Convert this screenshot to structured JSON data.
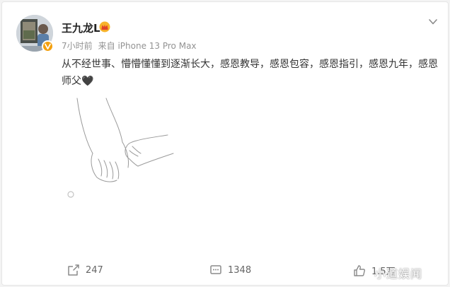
{
  "post": {
    "username": "王九龙L",
    "time": "7小时前",
    "source": "来自 iPhone 13 Pro Max",
    "text": "从不经世事、懵懵懂懂到逐渐长大，感恩教导，感恩包容，感恩指引，感恩九年，感恩师父🖤",
    "text_line1": "从不经世事、懵懵懂懂到逐渐长大，感恩教导，感恩包容，感恩指引，感恩九年，感恩",
    "text_line2": "师父🖤"
  },
  "icons": {
    "avatar": "avatar",
    "verified": "verified-badge-icon",
    "crown": "crown-icon",
    "more": "chevron-down-icon",
    "repost": "repost-icon",
    "comment": "comment-icon",
    "like": "like-icon"
  },
  "actions": {
    "repost_count": "247",
    "comment_count": "1348",
    "like_count": "1.5万"
  },
  "watermark": "小道娱闻",
  "colors": {
    "verified": "#f3a00f",
    "text": "#333333",
    "meta": "#939393",
    "action_icon": "#8a8a8a"
  }
}
